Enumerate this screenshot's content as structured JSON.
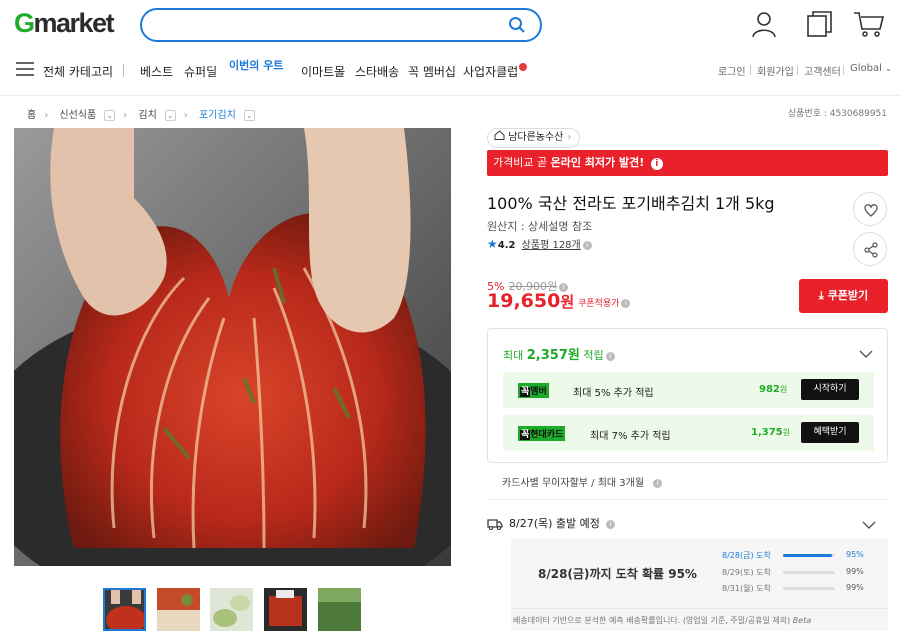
{
  "header": {
    "logo_g": "G",
    "logo_rest": "market",
    "search_placeholder": ""
  },
  "nav": {
    "all_categories": "전체 카테고리",
    "items": [
      "베스트",
      "슈퍼딜",
      "이마트몰",
      "스타배송",
      "꼭 멤버십",
      "사업자클럽"
    ],
    "fresh_label": "이번의 우트",
    "util": [
      "로그인",
      "회원가입",
      "고객센터",
      "Global"
    ]
  },
  "breadcrumb": {
    "home": "홈",
    "items": [
      "신선식품",
      "김치",
      "포기김치"
    ]
  },
  "product_no": "상품번호 : 4530689951",
  "store": {
    "name": "남다른농수산"
  },
  "promo": {
    "prefix": "가격비교 곧",
    "strong": "온라인 최저가 발견!"
  },
  "product": {
    "title": "100% 국산 전라도 포기배추김치 1개 5kg",
    "origin": "원산지 : 상세설명 참조",
    "rating": "4.2",
    "reviews": "상품평 128개",
    "discount": "5%",
    "original_price": "20,900원",
    "price": "19,650",
    "price_unit": "원",
    "coupon_applied": "쿠폰적용가",
    "coupon_button": "쿠폰받기"
  },
  "rewards": {
    "title_prefix": "최대",
    "title_amount": "2,357원",
    "title_suffix": "적립",
    "rows": [
      {
        "tag_mark": "꼭",
        "tag": "멤버",
        "text": "최대 5% 추가 적립",
        "amount": "982",
        "unit": "원",
        "button": "시작하기"
      },
      {
        "tag_mark": "꼭",
        "tag": "현대카드",
        "text": "최대 7% 추가 적립",
        "amount": "1,375",
        "unit": "원",
        "button": "혜택받기"
      }
    ]
  },
  "installment": "카드사별 무이자할부 / 최대 3개월",
  "shipping": {
    "label": "8/27(목) 출발 예정"
  },
  "delivery": {
    "headline": "8/28(금)까지 도착 확률 95%",
    "lines": [
      {
        "date": "8/28(금) 도착",
        "percent": "95%",
        "value": 0.95
      },
      {
        "date": "8/29(토) 도착",
        "percent": "99%",
        "value": 0.99
      },
      {
        "date": "8/31(월) 도착",
        "percent": "99%",
        "value": 0.99
      }
    ],
    "note": "배송데이터 기반으로 분석한 예측 배송확률입니다. (영업일 기준, 주말/공휴일 제외)",
    "note_tag": "Beta"
  },
  "colors": {
    "brand_green": "#1fab2a",
    "accent_red": "#e8212b",
    "accent_blue": "#1e7ad8"
  }
}
